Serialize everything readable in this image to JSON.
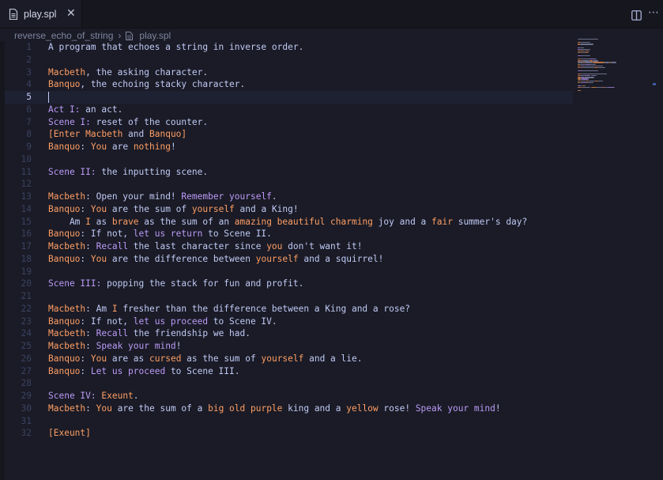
{
  "tab": {
    "filename": "play.spl"
  },
  "breadcrumb": {
    "folder": "reverse_echo_of_string",
    "file": "play.spl"
  },
  "editor": {
    "active_line": 5,
    "lines": [
      {
        "n": "1",
        "tokens": [
          {
            "t": "A program that echoes a string in inverse order.",
            "c": "plain"
          }
        ]
      },
      {
        "n": "2",
        "tokens": []
      },
      {
        "n": "3",
        "tokens": [
          {
            "t": "Macbeth",
            "c": "char"
          },
          {
            "t": ", the asking character.",
            "c": "plain"
          }
        ]
      },
      {
        "n": "4",
        "tokens": [
          {
            "t": "Banquo",
            "c": "char"
          },
          {
            "t": ", the echoing stacky character.",
            "c": "plain"
          }
        ]
      },
      {
        "n": "5",
        "tokens": []
      },
      {
        "n": "6",
        "tokens": [
          {
            "t": "Act I:",
            "c": "kw"
          },
          {
            "t": " an act.",
            "c": "plain"
          }
        ]
      },
      {
        "n": "7",
        "tokens": [
          {
            "t": "Scene I:",
            "c": "kw"
          },
          {
            "t": " reset of the counter.",
            "c": "plain"
          }
        ]
      },
      {
        "n": "8",
        "tokens": [
          {
            "t": "[Enter ",
            "c": "bracket"
          },
          {
            "t": "Macbeth",
            "c": "char"
          },
          {
            "t": " and ",
            "c": "plain"
          },
          {
            "t": "Banquo",
            "c": "char"
          },
          {
            "t": "]",
            "c": "bracket"
          }
        ]
      },
      {
        "n": "9",
        "tokens": [
          {
            "t": "Banquo",
            "c": "char"
          },
          {
            "t": ": ",
            "c": "plain"
          },
          {
            "t": "You",
            "c": "char"
          },
          {
            "t": " are ",
            "c": "plain"
          },
          {
            "t": "nothing",
            "c": "bad"
          },
          {
            "t": "!",
            "c": "plain"
          }
        ]
      },
      {
        "n": "10",
        "tokens": []
      },
      {
        "n": "11",
        "tokens": [
          {
            "t": "Scene II:",
            "c": "kw"
          },
          {
            "t": " the inputting scene.",
            "c": "plain"
          }
        ]
      },
      {
        "n": "12",
        "tokens": []
      },
      {
        "n": "13",
        "tokens": [
          {
            "t": "Macbeth",
            "c": "char"
          },
          {
            "t": ": Open your mind! ",
            "c": "plain"
          },
          {
            "t": "Remember yourself",
            "c": "kw"
          },
          {
            "t": ".",
            "c": "plain"
          }
        ]
      },
      {
        "n": "14",
        "tokens": [
          {
            "t": "Banquo",
            "c": "char"
          },
          {
            "t": ": ",
            "c": "plain"
          },
          {
            "t": "You",
            "c": "char"
          },
          {
            "t": " are the sum of ",
            "c": "plain"
          },
          {
            "t": "yourself",
            "c": "char"
          },
          {
            "t": " and a King!",
            "c": "plain"
          }
        ]
      },
      {
        "n": "15",
        "tokens": [
          {
            "t": "    Am ",
            "c": "plain"
          },
          {
            "t": "I",
            "c": "char"
          },
          {
            "t": " as ",
            "c": "plain"
          },
          {
            "t": "brave",
            "c": "adj"
          },
          {
            "t": " as the sum of an ",
            "c": "plain"
          },
          {
            "t": "amazing beautiful charming",
            "c": "adj"
          },
          {
            "t": " joy and a ",
            "c": "plain"
          },
          {
            "t": "fair",
            "c": "adj"
          },
          {
            "t": " summer's day?",
            "c": "plain"
          }
        ]
      },
      {
        "n": "16",
        "tokens": [
          {
            "t": "Banquo",
            "c": "char"
          },
          {
            "t": ": If not, ",
            "c": "plain"
          },
          {
            "t": "let us return",
            "c": "kw"
          },
          {
            "t": " to Scene II.",
            "c": "plain"
          }
        ]
      },
      {
        "n": "17",
        "tokens": [
          {
            "t": "Macbeth",
            "c": "char"
          },
          {
            "t": ": ",
            "c": "plain"
          },
          {
            "t": "Recall",
            "c": "kw"
          },
          {
            "t": " the last character since ",
            "c": "plain"
          },
          {
            "t": "you",
            "c": "char"
          },
          {
            "t": " don't want it!",
            "c": "plain"
          }
        ]
      },
      {
        "n": "18",
        "tokens": [
          {
            "t": "Banquo",
            "c": "char"
          },
          {
            "t": ": ",
            "c": "plain"
          },
          {
            "t": "You",
            "c": "char"
          },
          {
            "t": " are the difference between ",
            "c": "plain"
          },
          {
            "t": "yourself",
            "c": "char"
          },
          {
            "t": " and a squirrel!",
            "c": "plain"
          }
        ]
      },
      {
        "n": "19",
        "tokens": []
      },
      {
        "n": "20",
        "tokens": [
          {
            "t": "Scene III:",
            "c": "kw"
          },
          {
            "t": " popping the stack for fun and profit.",
            "c": "plain"
          }
        ]
      },
      {
        "n": "21",
        "tokens": []
      },
      {
        "n": "22",
        "tokens": [
          {
            "t": "Macbeth",
            "c": "char"
          },
          {
            "t": ": Am ",
            "c": "plain"
          },
          {
            "t": "I",
            "c": "char"
          },
          {
            "t": " fresher than the difference between a King and a rose?",
            "c": "plain"
          }
        ]
      },
      {
        "n": "23",
        "tokens": [
          {
            "t": "Banquo",
            "c": "char"
          },
          {
            "t": ": If not, ",
            "c": "plain"
          },
          {
            "t": "let us proceed",
            "c": "kw"
          },
          {
            "t": " to Scene IV.",
            "c": "plain"
          }
        ]
      },
      {
        "n": "24",
        "tokens": [
          {
            "t": "Macbeth",
            "c": "char"
          },
          {
            "t": ": ",
            "c": "plain"
          },
          {
            "t": "Recall",
            "c": "kw"
          },
          {
            "t": " the friendship we had.",
            "c": "plain"
          }
        ]
      },
      {
        "n": "25",
        "tokens": [
          {
            "t": "Macbeth",
            "c": "char"
          },
          {
            "t": ": ",
            "c": "plain"
          },
          {
            "t": "Speak your mind",
            "c": "kw"
          },
          {
            "t": "!",
            "c": "plain"
          }
        ]
      },
      {
        "n": "26",
        "tokens": [
          {
            "t": "Banquo",
            "c": "char"
          },
          {
            "t": ": ",
            "c": "plain"
          },
          {
            "t": "You",
            "c": "char"
          },
          {
            "t": " are as ",
            "c": "plain"
          },
          {
            "t": "cursed",
            "c": "bad"
          },
          {
            "t": " as the sum of ",
            "c": "plain"
          },
          {
            "t": "yourself",
            "c": "char"
          },
          {
            "t": " and a lie.",
            "c": "plain"
          }
        ]
      },
      {
        "n": "27",
        "tokens": [
          {
            "t": "Banquo",
            "c": "char"
          },
          {
            "t": ": ",
            "c": "plain"
          },
          {
            "t": "Let us proceed",
            "c": "kw"
          },
          {
            "t": " to Scene III.",
            "c": "plain"
          }
        ]
      },
      {
        "n": "28",
        "tokens": []
      },
      {
        "n": "29",
        "tokens": [
          {
            "t": "Scene IV:",
            "c": "kw"
          },
          {
            "t": " ",
            "c": "plain"
          },
          {
            "t": "Exeunt",
            "c": "char"
          },
          {
            "t": ".",
            "c": "plain"
          }
        ]
      },
      {
        "n": "30",
        "tokens": [
          {
            "t": "Macbeth",
            "c": "char"
          },
          {
            "t": ": ",
            "c": "plain"
          },
          {
            "t": "You",
            "c": "char"
          },
          {
            "t": " are the sum of a ",
            "c": "plain"
          },
          {
            "t": "big old purple",
            "c": "bad"
          },
          {
            "t": " king and a ",
            "c": "plain"
          },
          {
            "t": "yellow",
            "c": "char"
          },
          {
            "t": " rose! ",
            "c": "plain"
          },
          {
            "t": "Speak your mind",
            "c": "kw"
          },
          {
            "t": "!",
            "c": "plain"
          }
        ]
      },
      {
        "n": "31",
        "tokens": []
      },
      {
        "n": "32",
        "tokens": [
          {
            "t": "[Exeunt]",
            "c": "bracket"
          }
        ]
      }
    ]
  },
  "icons": {
    "file": "file-icon",
    "close": "close-icon",
    "split": "split-editor-icon",
    "more": "more-actions-icon"
  },
  "colors": {
    "background": "#1a1b26",
    "tabbar": "#16161e",
    "text": "#c0caf5",
    "character": "#ff9e64",
    "keyword": "#bb9af7",
    "adjective": "#ff9e64",
    "line_number": "#3b4261"
  }
}
